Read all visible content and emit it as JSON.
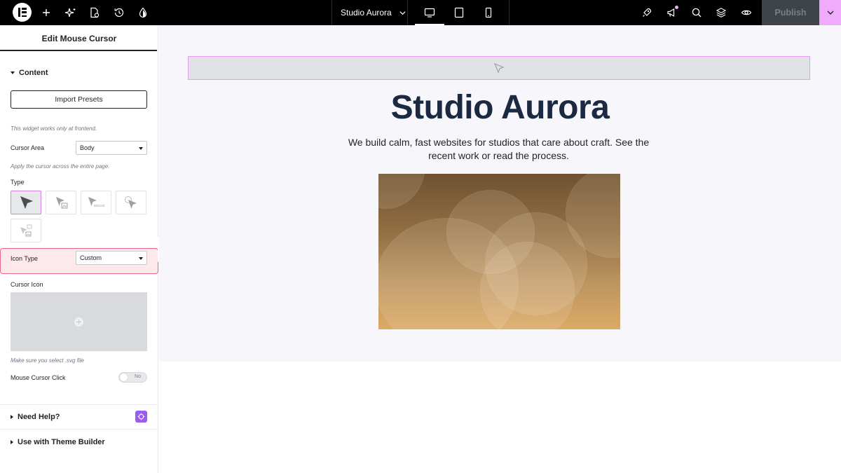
{
  "topbar": {
    "site_name": "Studio Aurora",
    "publish_label": "Publish",
    "colors": {
      "background": "#000000",
      "accent": "#f0abfc",
      "publish_disabled_bg": "#3f444b"
    },
    "icons": [
      "elementor-logo-icon",
      "add-icon",
      "ai-sparkle-icon",
      "page-settings-icon",
      "history-icon",
      "site-style-icon",
      "site-chevron-down-icon",
      "desktop-icon",
      "tablet-icon",
      "mobile-icon",
      "launchpad-icon",
      "notifications-icon",
      "search-icon",
      "structure-icon",
      "preview-icon",
      "publish-options-chevron-icon"
    ]
  },
  "panel": {
    "title": "Edit Mouse Cursor",
    "content_section": "Content",
    "import_presets": "Import Presets",
    "frontend_hint": "This widget works only at frontend.",
    "cursor_area": {
      "label": "Cursor Area",
      "value": "Body",
      "hint": "Apply the cursor across the entire page."
    },
    "type": {
      "label": "Type",
      "options": [
        "default-arrow",
        "arrow-with-image",
        "arrow-with-text",
        "arrow-with-circle",
        "image-only"
      ],
      "selected": 0,
      "tile_text": "MOUSE"
    },
    "icon_type": {
      "label": "Icon Type",
      "value": "Custom"
    },
    "cursor_icon": {
      "label": "Cursor Icon",
      "hint": "Make sure you select .svg file"
    },
    "mouse_click": {
      "label": "Mouse Cursor Click",
      "toggle_text": "No",
      "on": false
    },
    "need_help": "Need Help?",
    "theme_builder": "Use with Theme Builder",
    "colors": {
      "highlight_bg": "#fde8ec",
      "highlight_border": "#e86a88",
      "selected_tile_border": "#d580e4",
      "help_badge": "#9b5cf0"
    }
  },
  "canvas": {
    "hero_title": "Studio Aurora",
    "hero_text": "We build calm, fast websites for studios that care about craft. See the recent work or read the process.",
    "colors": {
      "page_bg": "#f7f7fb",
      "title": "#1b2a40",
      "widget_border": "#e79ef2"
    }
  }
}
